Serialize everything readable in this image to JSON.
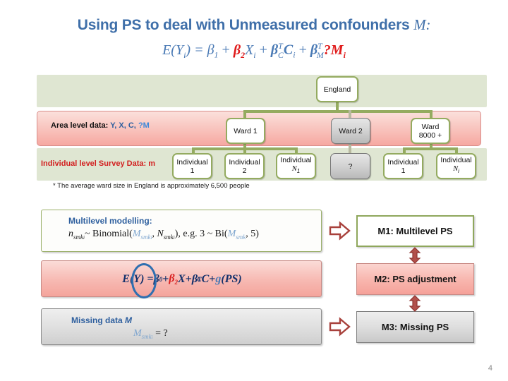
{
  "slide": {
    "title_text": "Using PS to deal with Unmeasured confounders",
    "title_italic": "M:",
    "equation": {
      "lhs": "E(Y",
      "full": "E(Yi) = β1 + β2Xi + βTC Ci + βTM ?Mi",
      "parts": {
        "e_open": "E(Y",
        "i1": "i",
        "e_close": ") = ",
        "beta1": "β",
        "one": "1",
        "plus1": " + ",
        "beta2": "β",
        "two": "2",
        "x": "X",
        "i2": "i",
        "plus2": " + ",
        "betaC": "β",
        "tc_sup": "T",
        "tc_sub": "C",
        "c": "C",
        "i3": "i",
        "plus3": " + ",
        "betaM": "β",
        "tm_sup": "T",
        "tm_sub": "M",
        "qm": "?M",
        "i4": "i"
      }
    },
    "page_number": "4"
  },
  "diagram": {
    "band_labels": {
      "area_prefix": "Area level data: ",
      "area_vars": "Y, X, C, ",
      "area_missing": "?M",
      "individual": "Individual level Survey Data: m"
    },
    "footnote": "* The average ward size in England is approximately 6,500 people",
    "nodes": {
      "root": "England",
      "ward1": "Ward 1",
      "ward2": "Ward 2",
      "ward_last_l1": "Ward",
      "ward_last_l2": "8000 +",
      "ind_w1_1_l1": "Individual",
      "ind_w1_1_l2": "1",
      "ind_w1_2_l1": "Individual",
      "ind_w1_2_l2": "2",
      "ind_w1_n_l1": "Individual",
      "ind_w1_n_l2": "N",
      "ind_w1_n_sub": "1",
      "ind_w2_q": "?",
      "ind_wl_1_l1": "Individual",
      "ind_wl_1_l2": "1",
      "ind_wl_n_l1": "Individual",
      "ind_wl_n_l2": "N",
      "ind_wl_n_sub": "i"
    }
  },
  "panels": {
    "multilevel": {
      "heading": "Multilevel modelling:",
      "equation_n": "n",
      "equation_n_sub": "smk",
      "equation_n_sub2": "i",
      "equation_mid": "~ Binomial(",
      "equation_M": "M",
      "equation_M_sub": "smk",
      "equation_M_sub2": "i",
      "equation_comma": ", ",
      "equation_N": "N",
      "equation_N_sub": "smk",
      "equation_N_sub2": "i",
      "equation_tail": "), e.g. 3 ~ Bi(",
      "equation_M2": "M",
      "equation_M2_sub": "smk",
      "equation_end": ", 5)"
    },
    "outcome": {
      "e_open": "E(Y) = ",
      "beta0": "β",
      "zero": "0",
      "plus1": " + ",
      "beta2": "β",
      "two": "2",
      "x": "X",
      "plus2": " + ",
      "betaC": "β",
      "tc_sup": "T",
      "tc_sub": "C",
      "c": "C",
      "plus3": " + ",
      "g": "g",
      "ps": "(PS)"
    },
    "missing": {
      "heading_text": "Missing data ",
      "heading_italic": "M",
      "equation_M": "M",
      "equation_M_sub": "smk",
      "equation_M_sub2": "i",
      "equation_eq": " = ?"
    }
  },
  "methods": {
    "m1": "M1: Multilevel PS",
    "m2": "M2: PS adjustment",
    "m3": "M3: Missing PS"
  },
  "colors": {
    "title_blue": "#3f6fa9",
    "accent_red": "#d21f1f",
    "band_green": "#dfe6d2",
    "band_pink": "#f6a8a1",
    "node_border_green": "#94ab60",
    "arrow_maroon": "#a8413c",
    "highlight_ellipse_blue": "#2f6fb0"
  }
}
